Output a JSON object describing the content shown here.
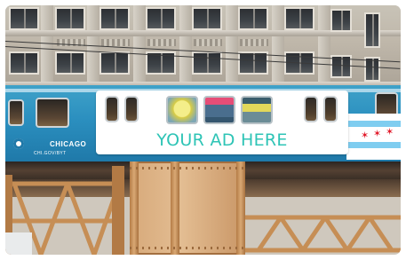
{
  "image": {
    "subject": "elevated-train-with-ad-banner",
    "colors": {
      "ad_text": "#2ec4b6",
      "train_body": "#2b8fbf",
      "structure": "#c08a52",
      "banner_bg": "#ffffff"
    }
  },
  "ad_banner": {
    "headline": "YOUR AD HERE"
  },
  "train_wrap": {
    "city_text": "CHICAGO",
    "url_text": "CHI.GOV/BYT"
  }
}
